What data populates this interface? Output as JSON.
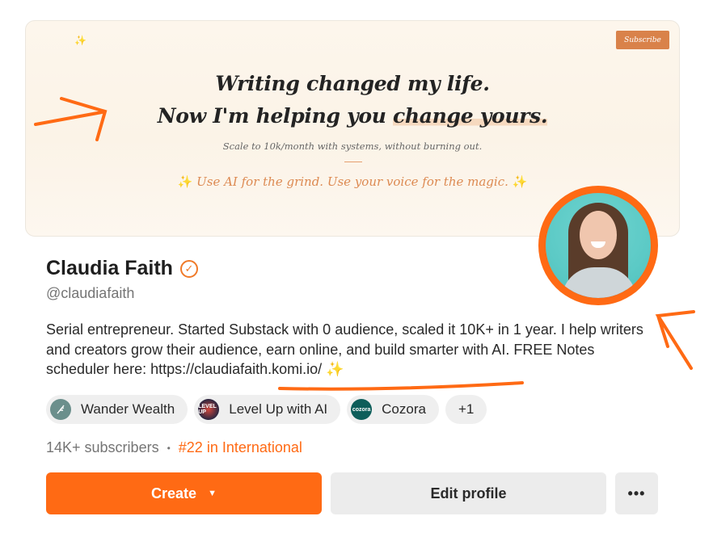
{
  "banner": {
    "subscribe_label": "Subscribe",
    "headline_line1": "Writing changed my life.",
    "headline_line2_pre": "Now I'm helping you ",
    "headline_line2_hl": "change yours.",
    "tagline": "Scale to 10k/month with systems, without burning out.",
    "ai_line": "Use AI for the grind. Use your voice for the magic.",
    "sparkle": "✨"
  },
  "profile": {
    "name": "Claudia Faith",
    "verified_icon": "✓",
    "handle": "@claudiafaith",
    "bio_text": "Serial entrepreneur. Started Substack with 0 audience, scaled it 10K+ in 1 year. I help writers and creators grow their audience, earn online, and build smarter with AI. FREE Notes scheduler here: ",
    "bio_link": "https://claudiafaith.komi.io/",
    "bio_emoji": "✨"
  },
  "publications": [
    {
      "label": "Wander Wealth",
      "icon": "feather-icon"
    },
    {
      "label": "Level Up with AI",
      "icon": "level-up-icon",
      "icon_text": "LEVEL UP"
    },
    {
      "label": "Cozora",
      "icon": "cozora-icon",
      "icon_text": "cozora"
    }
  ],
  "publications_more": "+1",
  "stats": {
    "subscribers": "14K+ subscribers",
    "separator": "•",
    "rank": "#22 in International"
  },
  "actions": {
    "create_label": "Create",
    "create_caret": "▼",
    "edit_label": "Edit profile",
    "more_label": "•••"
  },
  "colors": {
    "accent": "#ff6a14",
    "banner_bg": "#fdf6ec",
    "annotation": "#ff6a14"
  }
}
